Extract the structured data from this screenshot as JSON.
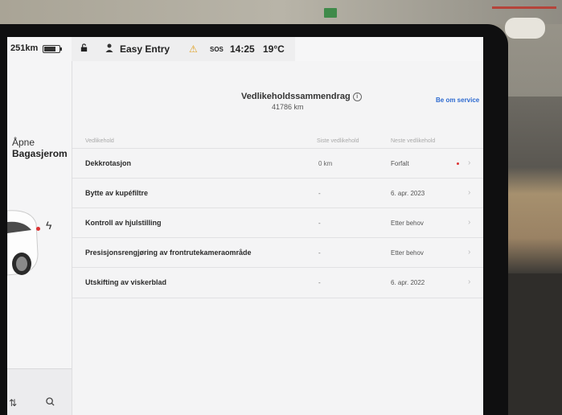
{
  "status_bar": {
    "user_label": "Easy Entry",
    "time": "14:25",
    "temperature": "19°C",
    "sos_label": "SOS"
  },
  "left_panel": {
    "range": "251km",
    "battery_level_pct": 80,
    "trunk_line1": "Åpne",
    "trunk_line2": "Bagasjerom"
  },
  "summary": {
    "title": "Vedlikeholdssammendrag",
    "odometer": "41786 km",
    "service_link": "Be om service"
  },
  "table": {
    "headers": {
      "name": "Vedlikehold",
      "last": "Siste vedlikehold",
      "next": "Neste vedlikehold"
    },
    "rows": [
      {
        "name": "Dekkrotasjon",
        "last": "0 km",
        "next": "Forfalt",
        "overdue": true
      },
      {
        "name": "Bytte av kupéfiltre",
        "last": "-",
        "next": "6. apr. 2023",
        "overdue": false
      },
      {
        "name": "Kontroll av hjulstilling",
        "last": "-",
        "next": "Etter behov",
        "overdue": false
      },
      {
        "name": "Presisjonsrengjøring av frontrutekameraområde",
        "last": "-",
        "next": "Etter behov",
        "overdue": false
      },
      {
        "name": "Utskifting av viskerblad",
        "last": "-",
        "next": "6. apr. 2022",
        "overdue": false
      }
    ]
  },
  "colors": {
    "accent": "#2d6ad0",
    "overdue": "#dd3333",
    "warning": "#e0a020"
  }
}
